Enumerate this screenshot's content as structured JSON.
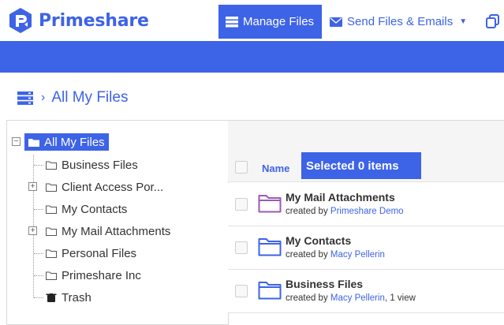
{
  "app": {
    "brand": "Primeshare"
  },
  "nav": {
    "manage_files": "Manage Files",
    "send_files": "Send Files & Emails"
  },
  "breadcrumb": {
    "current": "All My Files"
  },
  "tree": {
    "root": "All My Files",
    "items": [
      {
        "label": "Business Files",
        "expandable": false,
        "icon": "folder-icon"
      },
      {
        "label": "Client Access Por...",
        "expandable": true,
        "icon": "folder-icon"
      },
      {
        "label": "My Contacts",
        "expandable": false,
        "icon": "folder-icon"
      },
      {
        "label": "My Mail Attachments",
        "expandable": true,
        "icon": "folder-icon"
      },
      {
        "label": "Personal Files",
        "expandable": false,
        "icon": "folder-icon"
      },
      {
        "label": "Primeshare Inc",
        "expandable": false,
        "icon": "folder-icon"
      },
      {
        "label": "Trash",
        "expandable": false,
        "icon": "trash-icon"
      }
    ]
  },
  "list": {
    "column_name": "Name",
    "selected_label": "Selected 0 items",
    "files": [
      {
        "name": "My Mail Attachments",
        "created_by": "created by ",
        "user": "Primeshare Demo",
        "suffix": "",
        "color": "#9b59b6"
      },
      {
        "name": "My Contacts",
        "created_by": "created by ",
        "user": "Macy Pellerin",
        "suffix": "",
        "color": "#3d63e6"
      },
      {
        "name": "Business Files",
        "created_by": "created by ",
        "user": "Macy Pellerin",
        "suffix": ", 1 view",
        "color": "#3d63e6"
      }
    ]
  },
  "colors": {
    "accent": "#3d63e6",
    "purple_folder": "#9b59b6"
  }
}
